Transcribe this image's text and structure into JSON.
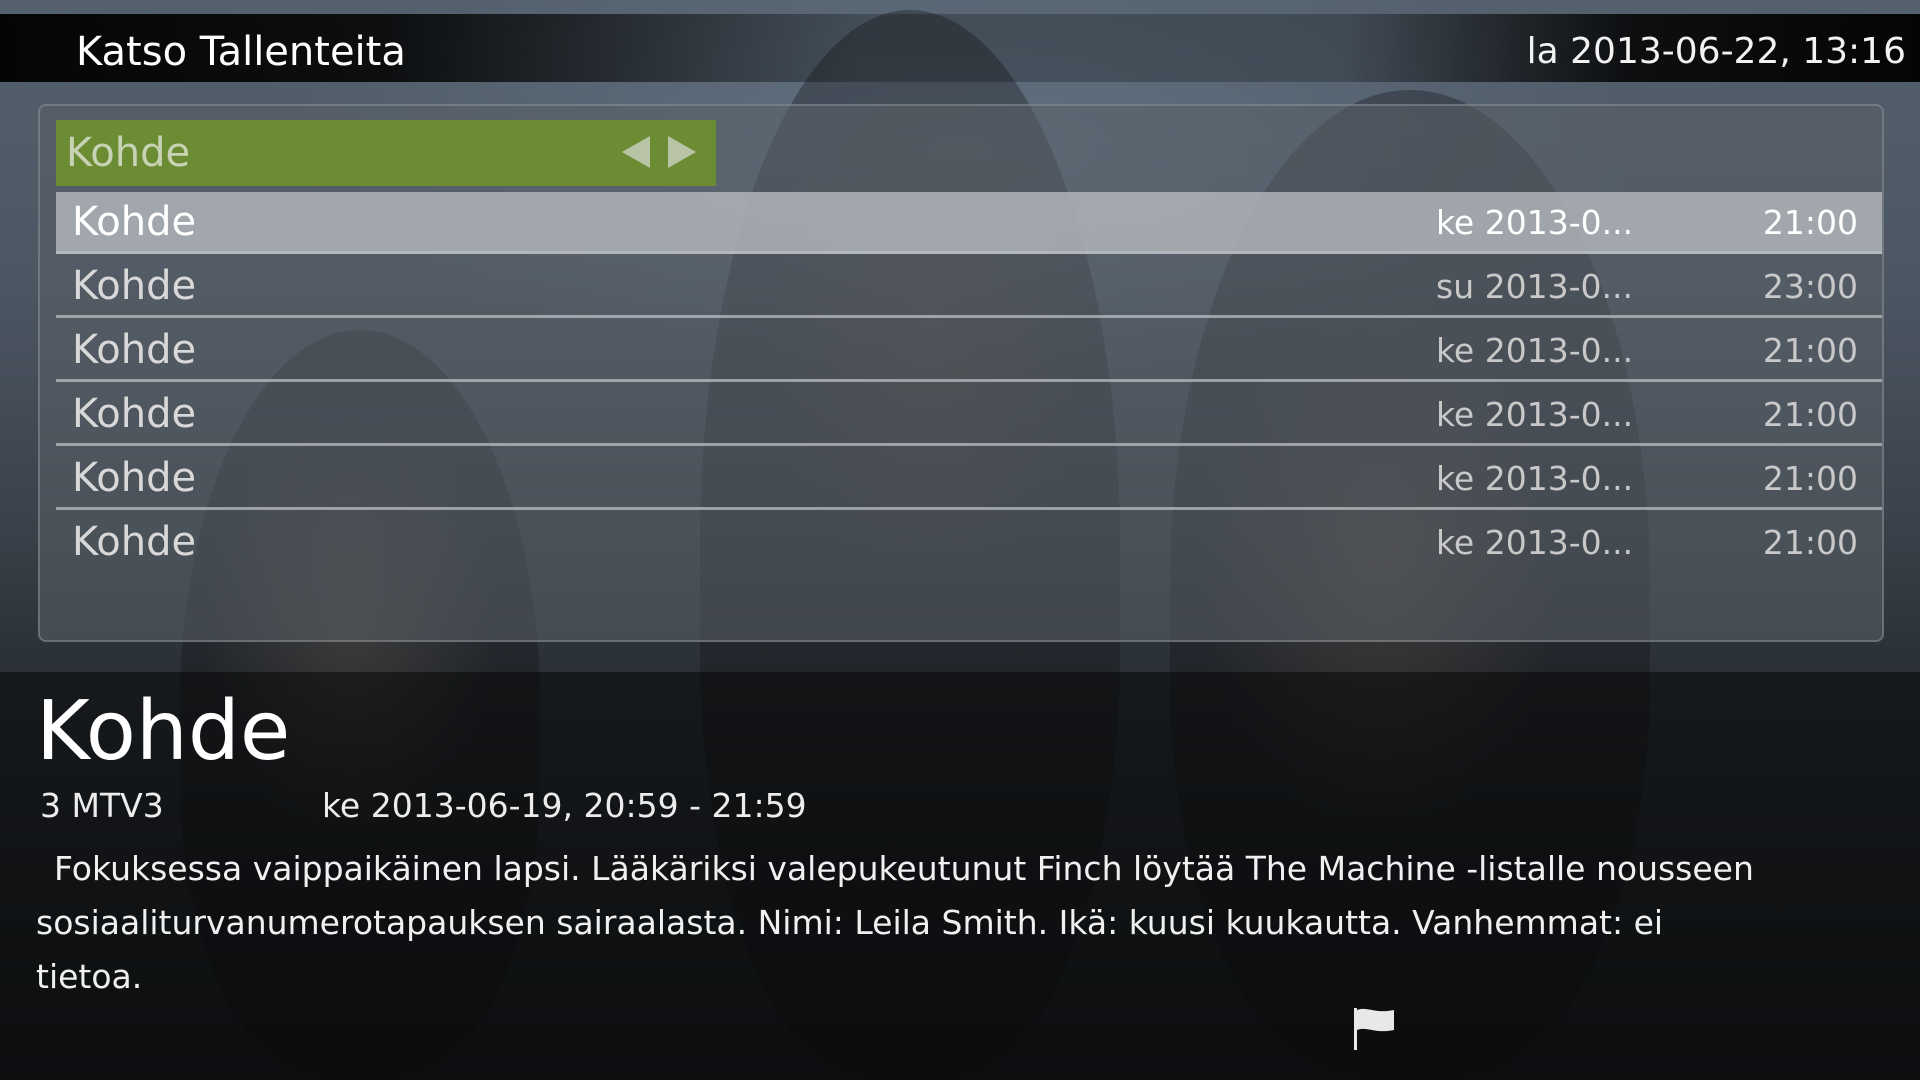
{
  "header": {
    "title": "Katso Tallenteita",
    "clock": "la 2013-06-22, 13:16"
  },
  "filter": {
    "label": "Kohde",
    "prev_icon": "arrow-left-icon",
    "next_icon": "arrow-right-icon"
  },
  "recordings": [
    {
      "title": "Kohde",
      "date": "ke 2013-0...",
      "time": "21:00",
      "selected": true
    },
    {
      "title": "Kohde",
      "date": "su 2013-0...",
      "time": "23:00",
      "selected": false
    },
    {
      "title": "Kohde",
      "date": "ke 2013-0...",
      "time": "21:00",
      "selected": false
    },
    {
      "title": "Kohde",
      "date": "ke 2013-0...",
      "time": "21:00",
      "selected": false
    },
    {
      "title": "Kohde",
      "date": "ke 2013-0...",
      "time": "21:00",
      "selected": false
    },
    {
      "title": "Kohde",
      "date": "ke 2013-0...",
      "time": "21:00",
      "selected": false
    }
  ],
  "details": {
    "title": "Kohde",
    "channel": "3 MTV3",
    "airtime": "ke 2013-06-19, 20:59 - 21:59",
    "description": "Fokuksessa vaippaikäinen lapsi. Lääkäriksi valepukeutunut Finch löytää The Machine -listalle nousseen sosiaaliturvanumerotapauksen sairaalasta. Nimi: Leila Smith. Ikä: kuusi kuukautta. Vanhemmat: ei tietoa.",
    "flag_icon": "flag-icon"
  },
  "colors": {
    "filter_bar": "#6c8c34",
    "selected_row": "#afb4ba"
  }
}
